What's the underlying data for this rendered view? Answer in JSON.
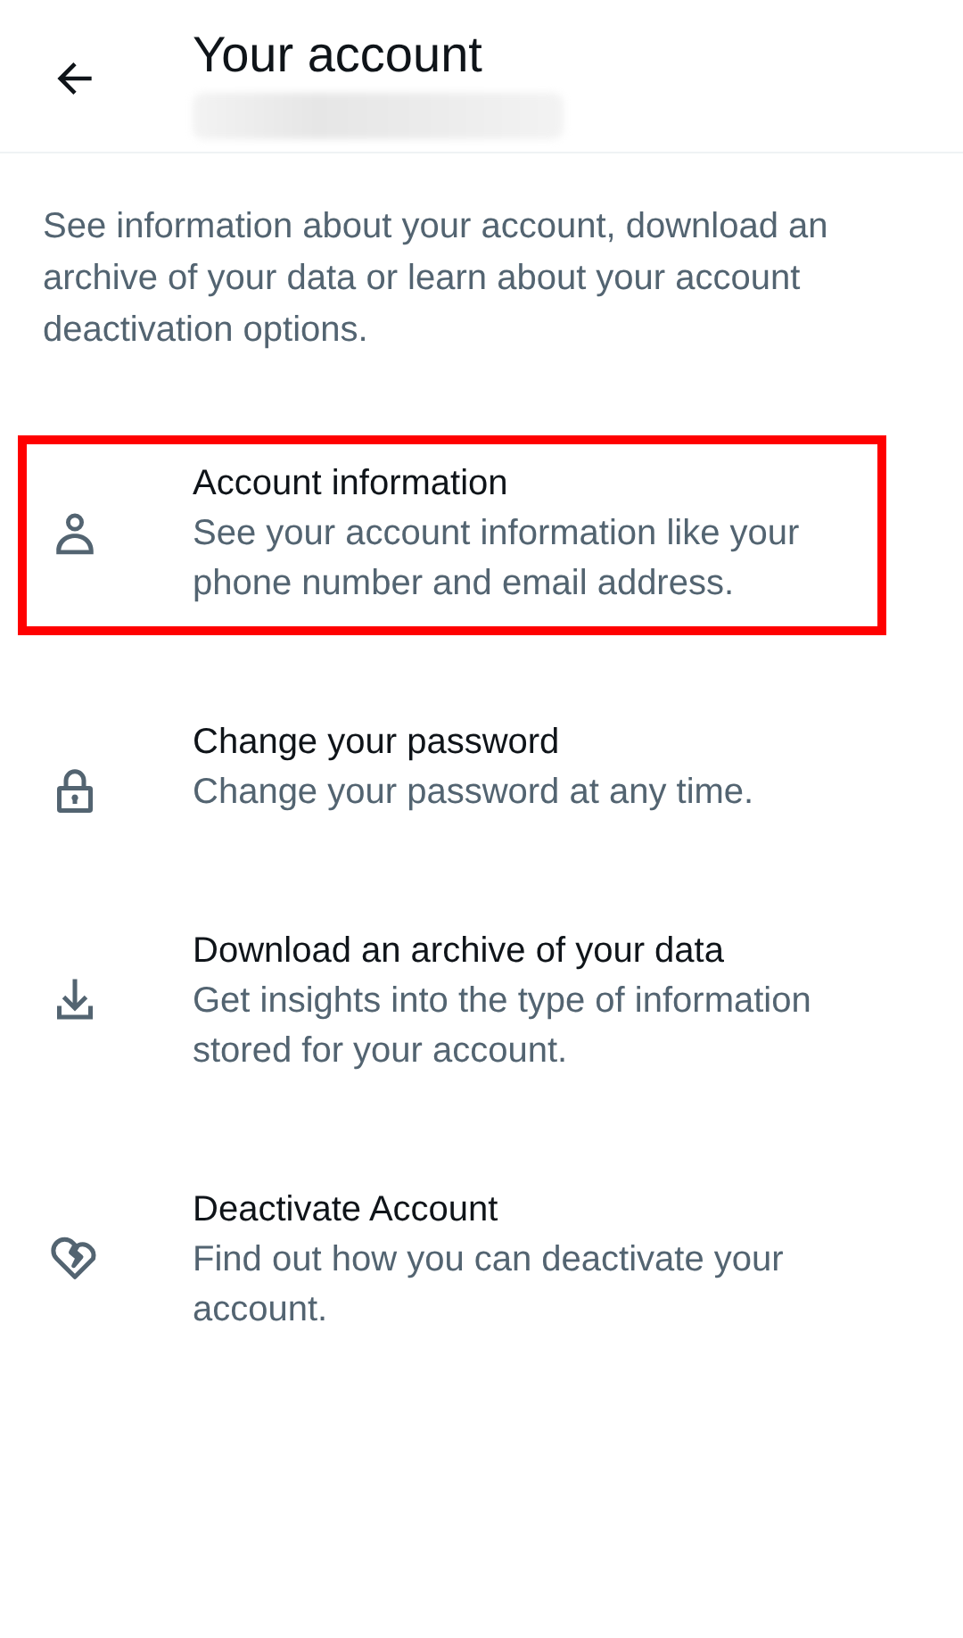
{
  "header": {
    "title": "Your account",
    "subtitle_redacted": true
  },
  "description": "See information about your account, download an archive of your data or learn about your account deactivation options.",
  "items": [
    {
      "kind": "person",
      "title": "Account information",
      "subtitle": "See your account information like your phone number and email address.",
      "highlighted": true
    },
    {
      "kind": "lock",
      "title": "Change your password",
      "subtitle": "Change your password at any time.",
      "highlighted": false
    },
    {
      "kind": "download",
      "title": "Download an archive of your data",
      "subtitle": "Get insights into the type of information stored for your account.",
      "highlighted": false
    },
    {
      "kind": "heart",
      "title": "Deactivate Account",
      "subtitle": "Find out how you can deactivate your account.",
      "highlighted": false
    }
  ]
}
